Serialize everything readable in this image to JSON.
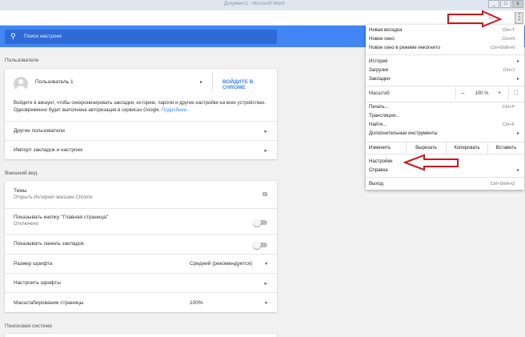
{
  "window": {
    "title": "Документ1 - Microsoft Word",
    "minimize": "_",
    "restore": "□",
    "close": "x"
  },
  "toolbar": {
    "bookmark_star": "☆",
    "menu_icon": "⋮"
  },
  "search": {
    "icon": "search-icon",
    "placeholder": "Поиск настроек"
  },
  "users": {
    "section_title": "Пользователи",
    "user_name": "Пользователь 1",
    "signin_button": "ВОЙДИТЕ В CHROME",
    "description": "Войдите в аккаунт, чтобы синхронизировать закладки, историю, пароли и другие настройки на всех устройствах. Одновременно будет выполнена авторизация в сервисах Google.",
    "more_link": "Подробнее...",
    "other_users": "Другие пользователи",
    "import": "Импорт закладок и настроек"
  },
  "appearance": {
    "section_title": "Внешний вид",
    "themes": "Темы",
    "themes_sub": "Открыть Интернет-магазин Chrome",
    "home_button": "Показывать кнопку \"Главная страница\"",
    "home_button_sub": "Отключено",
    "bookmarks_bar": "Показывать панель закладок",
    "font_size": "Размер шрифта",
    "font_size_value": "Средний (рекомендуется)",
    "customize_fonts": "Настроить шрифты",
    "page_zoom": "Масштабирование страницы",
    "page_zoom_value": "100%"
  },
  "search_engine": {
    "section_title": "Поисковая система"
  },
  "chrome_menu": {
    "new_tab": "Новая вкладка",
    "new_tab_sc": "Ctrl+T",
    "new_window": "Новое окно",
    "new_window_sc": "Ctrl+N",
    "incognito": "Новое окно в режиме инкогнито",
    "incognito_sc": "Ctrl+Shift+N",
    "history": "История",
    "downloads": "Загрузки",
    "downloads_sc": "Ctrl+J",
    "bookmarks": "Закладки",
    "zoom": "Масштаб",
    "zoom_minus": "–",
    "zoom_value": "100 %",
    "zoom_plus": "+",
    "fullscreen": "⛶",
    "print": "Печать...",
    "print_sc": "Ctrl+P",
    "cast": "Трансляция...",
    "find": "Найти...",
    "find_sc": "Ctrl+F",
    "more_tools": "Дополнительные инструменты",
    "edit": "Изменить",
    "cut": "Вырезать",
    "copy": "Копировать",
    "paste": "Вставить",
    "settings": "Настройки",
    "help": "Справка",
    "exit": "Выход",
    "exit_sc": "Ctrl+Shift+Q"
  },
  "colors": {
    "accent": "#4285f4",
    "annotation": "#d0141e"
  }
}
